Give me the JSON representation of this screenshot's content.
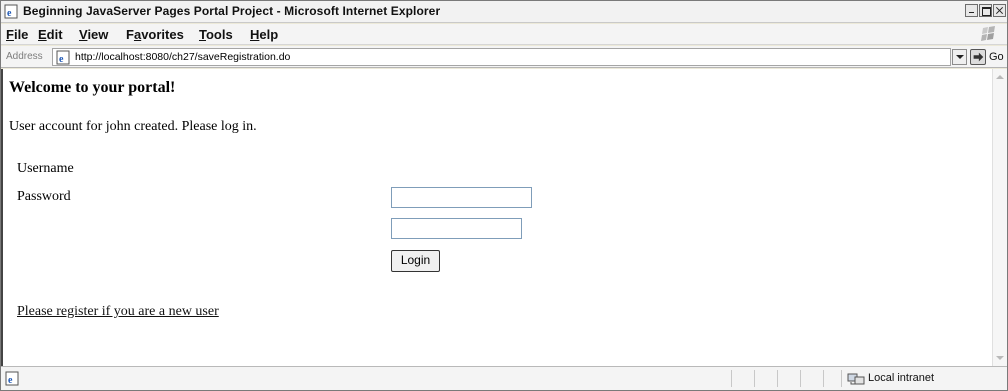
{
  "window": {
    "title": "Beginning JavaServer Pages Portal Project - Microsoft Internet Explorer"
  },
  "menu": [
    {
      "accel": "F",
      "rest": "ile"
    },
    {
      "accel": "E",
      "rest": "dit"
    },
    {
      "accel": "V",
      "rest": "iew"
    },
    {
      "pre": "F",
      "accel": "a",
      "rest": "vorites"
    },
    {
      "accel": "T",
      "rest": "ools"
    },
    {
      "accel": "H",
      "rest": "elp"
    }
  ],
  "address": {
    "label": "Address",
    "url": "http://localhost:8080/ch27/saveRegistration.do",
    "go_label": "Go"
  },
  "page": {
    "heading": "Welcome to your portal!",
    "message": "User account for john created. Please log in.",
    "username_label": "Username",
    "username_value": "",
    "password_label": "Password",
    "password_value": "",
    "login_label": "Login",
    "register_link": "Please register if you are a new user"
  },
  "status": {
    "text": "",
    "zone": "Local intranet"
  },
  "icons": {
    "title": "ie-page-icon",
    "address": "ie-page-icon",
    "go": "green-arrow-icon",
    "zone": "intranet-icon"
  }
}
